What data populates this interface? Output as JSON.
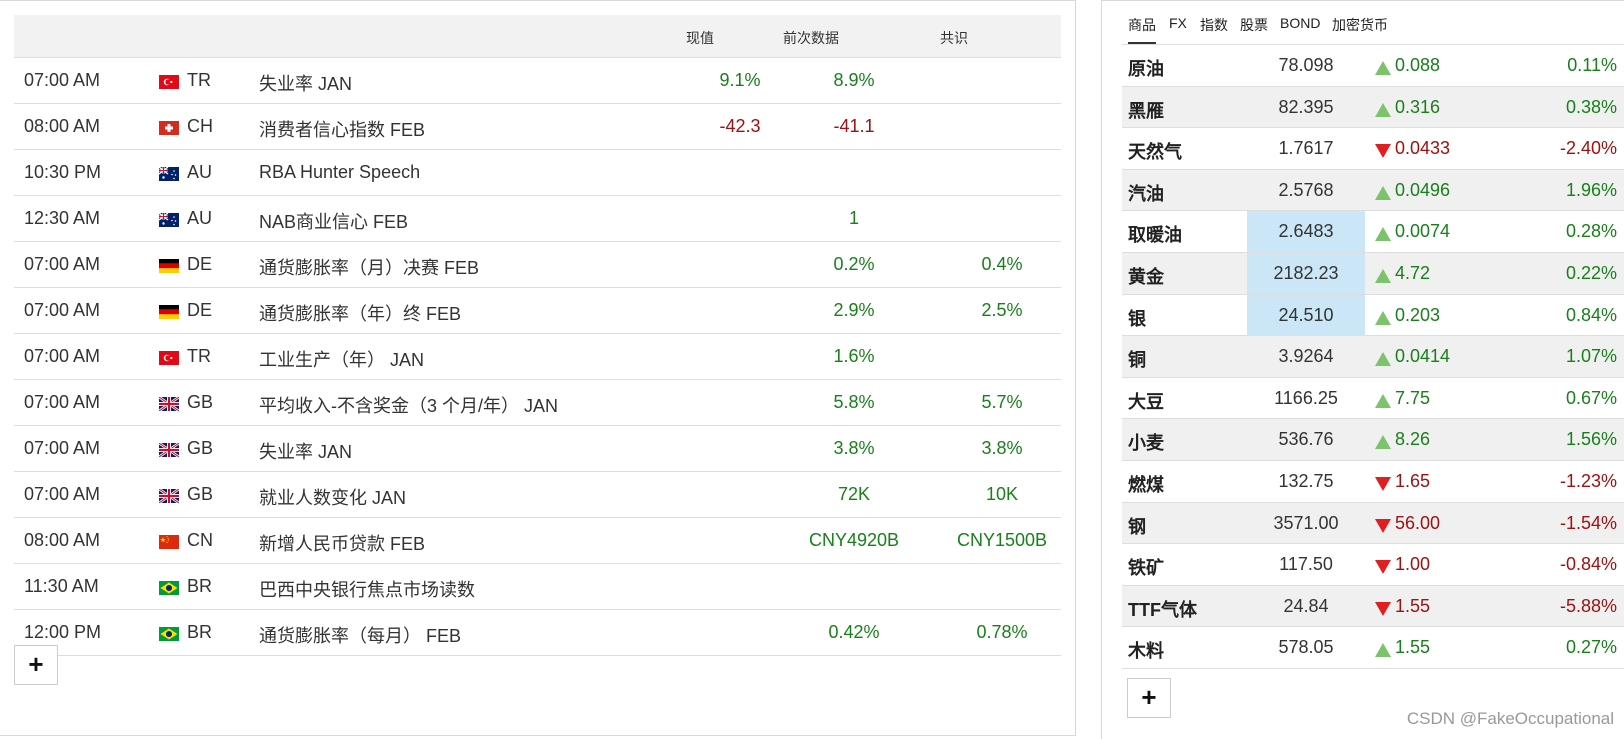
{
  "calendar": {
    "headers": {
      "actual": "现值",
      "previous": "前次数据",
      "consensus": "共识"
    },
    "rows": [
      {
        "time": "07:00 AM",
        "flag": "tr",
        "country": "TR",
        "event": "失业率  JAN",
        "actual": "9.1%",
        "actual_color": "green",
        "previous": "8.9%",
        "previous_color": "green",
        "consensus": ""
      },
      {
        "time": "08:00 AM",
        "flag": "ch",
        "country": "CH",
        "event": "消费者信心指数  FEB",
        "actual": "-42.3",
        "actual_color": "red",
        "previous": "-41.1",
        "previous_color": "red",
        "consensus": ""
      },
      {
        "time": "10:30 PM",
        "flag": "au",
        "country": "AU",
        "event": "RBA Hunter Speech",
        "actual": "",
        "previous": "",
        "consensus": ""
      },
      {
        "time": "12:30 AM",
        "flag": "au",
        "country": "AU",
        "event": "NAB商业信心  FEB",
        "actual": "",
        "previous": "1",
        "previous_color": "green",
        "consensus": ""
      },
      {
        "time": "07:00 AM",
        "flag": "de",
        "country": "DE",
        "event": "通货膨胀率（月）决赛  FEB",
        "actual": "",
        "previous": "0.2%",
        "previous_color": "green",
        "consensus": "0.4%"
      },
      {
        "time": "07:00 AM",
        "flag": "de",
        "country": "DE",
        "event": "通货膨胀率（年）终  FEB",
        "actual": "",
        "previous": "2.9%",
        "previous_color": "green",
        "consensus": "2.5%"
      },
      {
        "time": "07:00 AM",
        "flag": "tr",
        "country": "TR",
        "event": "工业生产（年）   JAN",
        "actual": "",
        "previous": "1.6%",
        "previous_color": "green",
        "consensus": ""
      },
      {
        "time": "07:00 AM",
        "flag": "gb",
        "country": "GB",
        "event": "平均收入-不含奖金（3 个月/年）   JAN",
        "actual": "",
        "previous": "5.8%",
        "previous_color": "green",
        "consensus": "5.7%"
      },
      {
        "time": "07:00 AM",
        "flag": "gb",
        "country": "GB",
        "event": "失业率  JAN",
        "actual": "",
        "previous": "3.8%",
        "previous_color": "green",
        "consensus": "3.8%"
      },
      {
        "time": "07:00 AM",
        "flag": "gb",
        "country": "GB",
        "event": "就业人数变化  JAN",
        "actual": "",
        "previous": "72K",
        "previous_color": "green",
        "consensus": "10K"
      },
      {
        "time": "08:00 AM",
        "flag": "cn",
        "country": "CN",
        "event": "新增人民币贷款  FEB",
        "actual": "",
        "previous": "CNY4920B",
        "previous_color": "green",
        "consensus": "CNY1500B"
      },
      {
        "time": "11:30 AM",
        "flag": "br",
        "country": "BR",
        "event": "巴西中央银行焦点市场读数",
        "actual": "",
        "previous": "",
        "consensus": ""
      },
      {
        "time": "12:00 PM",
        "flag": "br",
        "country": "BR",
        "event": "通货膨胀率（每月）   FEB",
        "actual": "",
        "previous": "0.42%",
        "previous_color": "green",
        "consensus": "0.78%"
      }
    ],
    "add_label": "+"
  },
  "markets": {
    "tabs": [
      "商品",
      "FX",
      "指数",
      "股票",
      "BOND",
      "加密货币"
    ],
    "active_tab": "商品",
    "rows": [
      {
        "name": "原油",
        "price": "78.098",
        "direction": "up",
        "change": "0.088",
        "pct": "0.11%"
      },
      {
        "name": "黑雁",
        "price": "82.395",
        "direction": "up",
        "change": "0.316",
        "pct": "0.38%"
      },
      {
        "name": "天然气",
        "price": "1.7617",
        "direction": "down",
        "change": "0.0433",
        "pct": "-2.40%"
      },
      {
        "name": "汽油",
        "price": "2.5768",
        "direction": "up",
        "change": "0.0496",
        "pct": "1.96%"
      },
      {
        "name": "取暖油",
        "price": "2.6483",
        "direction": "up",
        "change": "0.0074",
        "pct": "0.28%",
        "highlight": true
      },
      {
        "name": "黄金",
        "price": "2182.23",
        "direction": "up",
        "change": "4.72",
        "pct": "0.22%",
        "highlight": true
      },
      {
        "name": "银",
        "price": "24.510",
        "direction": "up",
        "change": "0.203",
        "pct": "0.84%",
        "highlight": true
      },
      {
        "name": "铜",
        "price": "3.9264",
        "direction": "up",
        "change": "0.0414",
        "pct": "1.07%"
      },
      {
        "name": "大豆",
        "price": "1166.25",
        "direction": "up",
        "change": "7.75",
        "pct": "0.67%"
      },
      {
        "name": "小麦",
        "price": "536.76",
        "direction": "up",
        "change": "8.26",
        "pct": "1.56%"
      },
      {
        "name": "燃煤",
        "price": "132.75",
        "direction": "down",
        "change": "1.65",
        "pct": "-1.23%"
      },
      {
        "name": "钢",
        "price": "3571.00",
        "direction": "down",
        "change": "56.00",
        "pct": "-1.54%"
      },
      {
        "name": "铁矿",
        "price": "117.50",
        "direction": "down",
        "change": "1.00",
        "pct": "-0.84%"
      },
      {
        "name": "TTF气体",
        "price": "24.84",
        "direction": "down",
        "change": "1.55",
        "pct": "-5.88%"
      },
      {
        "name": "木料",
        "price": "578.05",
        "direction": "up",
        "change": "1.55",
        "pct": "0.27%"
      }
    ],
    "add_label": "+"
  },
  "watermark": "CSDN @FakeOccupational",
  "colors": {
    "green": "#18801a",
    "red": "#a11010",
    "up_arrow": "#7cc36b",
    "down_arrow": "#e02020",
    "highlight": "#cbe7f7"
  }
}
